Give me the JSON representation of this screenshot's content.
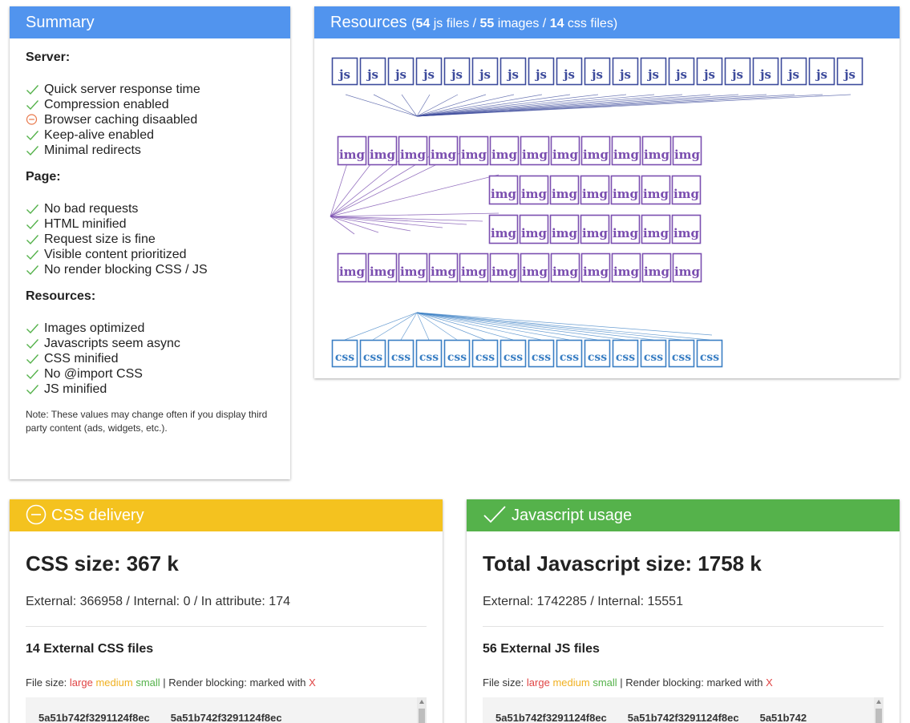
{
  "summary": {
    "title": "Summary",
    "sections": [
      {
        "title": "Server:",
        "items": [
          {
            "label": "Quick server response time",
            "status": "ok"
          },
          {
            "label": "Compression enabled",
            "status": "ok"
          },
          {
            "label": "Browser caching disaabled",
            "status": "warn"
          },
          {
            "label": "Keep-alive enabled",
            "status": "ok"
          },
          {
            "label": "Minimal redirects",
            "status": "ok"
          }
        ]
      },
      {
        "title": "Page:",
        "items": [
          {
            "label": "No bad requests",
            "status": "ok"
          },
          {
            "label": "HTML minified",
            "status": "ok"
          },
          {
            "label": "Request size is fine",
            "status": "ok"
          },
          {
            "label": "Visible content prioritized",
            "status": "ok"
          },
          {
            "label": "No render blocking CSS / JS",
            "status": "ok"
          }
        ]
      },
      {
        "title": "Resources:",
        "items": [
          {
            "label": "Images optimized",
            "status": "ok"
          },
          {
            "label": "Javascripts seem async",
            "status": "ok"
          },
          {
            "label": "CSS minified",
            "status": "ok"
          },
          {
            "label": "No @import CSS",
            "status": "ok"
          },
          {
            "label": "JS minified",
            "status": "ok"
          }
        ]
      }
    ],
    "note": "Note: These values may change often if you display third party content (ads, widgets, etc.)."
  },
  "resources": {
    "title": "Resources",
    "paren_open": "(",
    "js_count": "54",
    "js_label": " js files / ",
    "img_count": "55",
    "img_label": " images / ",
    "css_count": "14",
    "css_label": " css files)",
    "js_box_label": "js",
    "img_box_label": "img",
    "css_box_label": "css",
    "js_boxes_shown": 19,
    "img_rows": [
      12,
      7,
      7,
      12
    ],
    "css_boxes_shown": 14
  },
  "css_delivery": {
    "title": "CSS delivery",
    "status": "warn",
    "size_title": "CSS size: 367 k",
    "breakdown": "External: 366958 / Internal: 0 / In attribute: 174",
    "files_title": "14 External CSS files",
    "legend_prefix": "File size: ",
    "legend_large": "large",
    "legend_medium": "medium",
    "legend_small": "small",
    "legend_mid": " | Render blocking: marked with ",
    "legend_x": "X",
    "files": [
      "5a51b742f3291124f8ec",
      "5a51b742f3291124f8ec"
    ]
  },
  "js_usage": {
    "title": "Javascript usage",
    "status": "ok",
    "size_title": "Total Javascript size: 1758 k",
    "breakdown": "External: 1742285 / Internal: 15551",
    "files_title": "56 External JS files",
    "legend_prefix": "File size: ",
    "legend_large": "large",
    "legend_medium": "medium",
    "legend_small": "small",
    "legend_mid": " | Render blocking: marked with ",
    "legend_x": "X",
    "files": [
      "5a51b742f3291124f8ec",
      "5a51b742f3291124f8ec",
      "5a51b742"
    ]
  },
  "colors": {
    "blue_header": "#5194ee",
    "yellow_header": "#f4c21f",
    "green_header": "#55b24b",
    "js_box": "#3d4b9c",
    "img_box": "#7b4fb0",
    "css_box": "#3a7fc4",
    "ok_icon": "#55b24b",
    "warn_icon": "#e8774a"
  }
}
